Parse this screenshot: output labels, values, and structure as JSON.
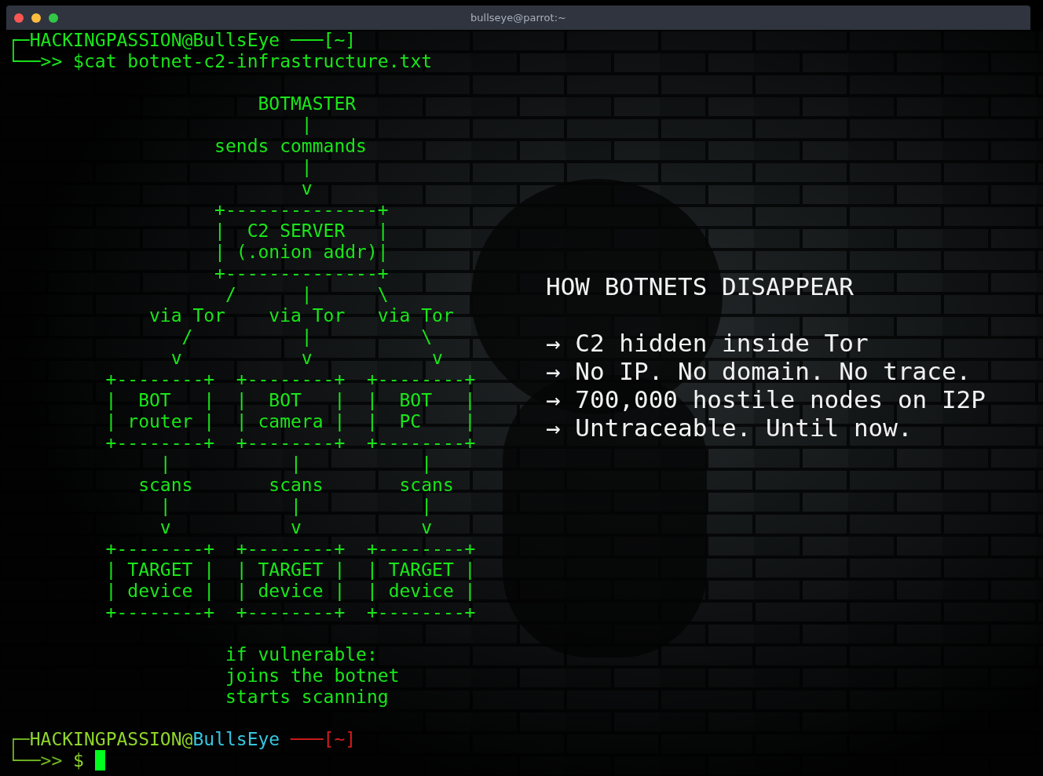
{
  "window": {
    "title": "bullseye@parrot:~"
  },
  "terminal": {
    "lines": [
      {
        "kind": "prompt",
        "current": false,
        "corner": "┌─",
        "user": "HACKINGPASSION",
        "at": "@",
        "host": "BullsEye",
        "path": "───[~]",
        "arrow": "└──>>",
        "symbol": "$",
        "command": "cat botnet-c2-infrastructure.txt"
      },
      {
        "kind": "blank"
      },
      {
        "kind": "output",
        "text": "                       BOTMASTER"
      },
      {
        "kind": "output",
        "text": "                           |"
      },
      {
        "kind": "output",
        "text": "                   sends commands"
      },
      {
        "kind": "output",
        "text": "                           |"
      },
      {
        "kind": "output",
        "text": "                           v"
      },
      {
        "kind": "output",
        "text": "                   +--------------+"
      },
      {
        "kind": "output",
        "text": "                   |  C2 SERVER   |"
      },
      {
        "kind": "output",
        "text": "                   | (.onion addr)|"
      },
      {
        "kind": "output",
        "text": "                   +--------------+"
      },
      {
        "kind": "output",
        "text": "                    /      |      \\"
      },
      {
        "kind": "output",
        "text": "             via Tor    via Tor   via Tor"
      },
      {
        "kind": "output",
        "text": "                /          |          \\"
      },
      {
        "kind": "output",
        "text": "               v           v           v"
      },
      {
        "kind": "output",
        "text": "         +--------+  +--------+  +--------+"
      },
      {
        "kind": "output",
        "text": "         |  BOT   |  |  BOT   |  |  BOT   |"
      },
      {
        "kind": "output",
        "text": "         | router |  | camera |  |  PC    |"
      },
      {
        "kind": "output",
        "text": "         +--------+  +--------+  +--------+"
      },
      {
        "kind": "output",
        "text": "              |           |           |"
      },
      {
        "kind": "output",
        "text": "            scans       scans       scans"
      },
      {
        "kind": "output",
        "text": "              |           |           |"
      },
      {
        "kind": "output",
        "text": "              v           v           v"
      },
      {
        "kind": "output",
        "text": "         +--------+  +--------+  +--------+"
      },
      {
        "kind": "output",
        "text": "         | TARGET |  | TARGET |  | TARGET |"
      },
      {
        "kind": "output",
        "text": "         | device |  | device |  | device |"
      },
      {
        "kind": "output",
        "text": "         +--------+  +--------+  +--------+"
      },
      {
        "kind": "blank"
      },
      {
        "kind": "output",
        "text": "                    if vulnerable:"
      },
      {
        "kind": "output",
        "text": "                    joins the botnet"
      },
      {
        "kind": "output",
        "text": "                    starts scanning"
      },
      {
        "kind": "blank"
      },
      {
        "kind": "prompt",
        "current": true,
        "corner": "┌─",
        "user": "HACKINGPASSION",
        "at": "@",
        "host": "BullsEye",
        "path": "───[~]",
        "arrow": "└──>>",
        "symbol": "$"
      }
    ]
  },
  "overlay": {
    "heading": "HOW BOTNETS DISAPPEAR",
    "points": [
      "→ C2 hidden inside Tor",
      "→ No IP. No domain. No trace.",
      "→ 700,000 hostile nodes on I2P",
      "→ Untraceable. Until now."
    ]
  }
}
